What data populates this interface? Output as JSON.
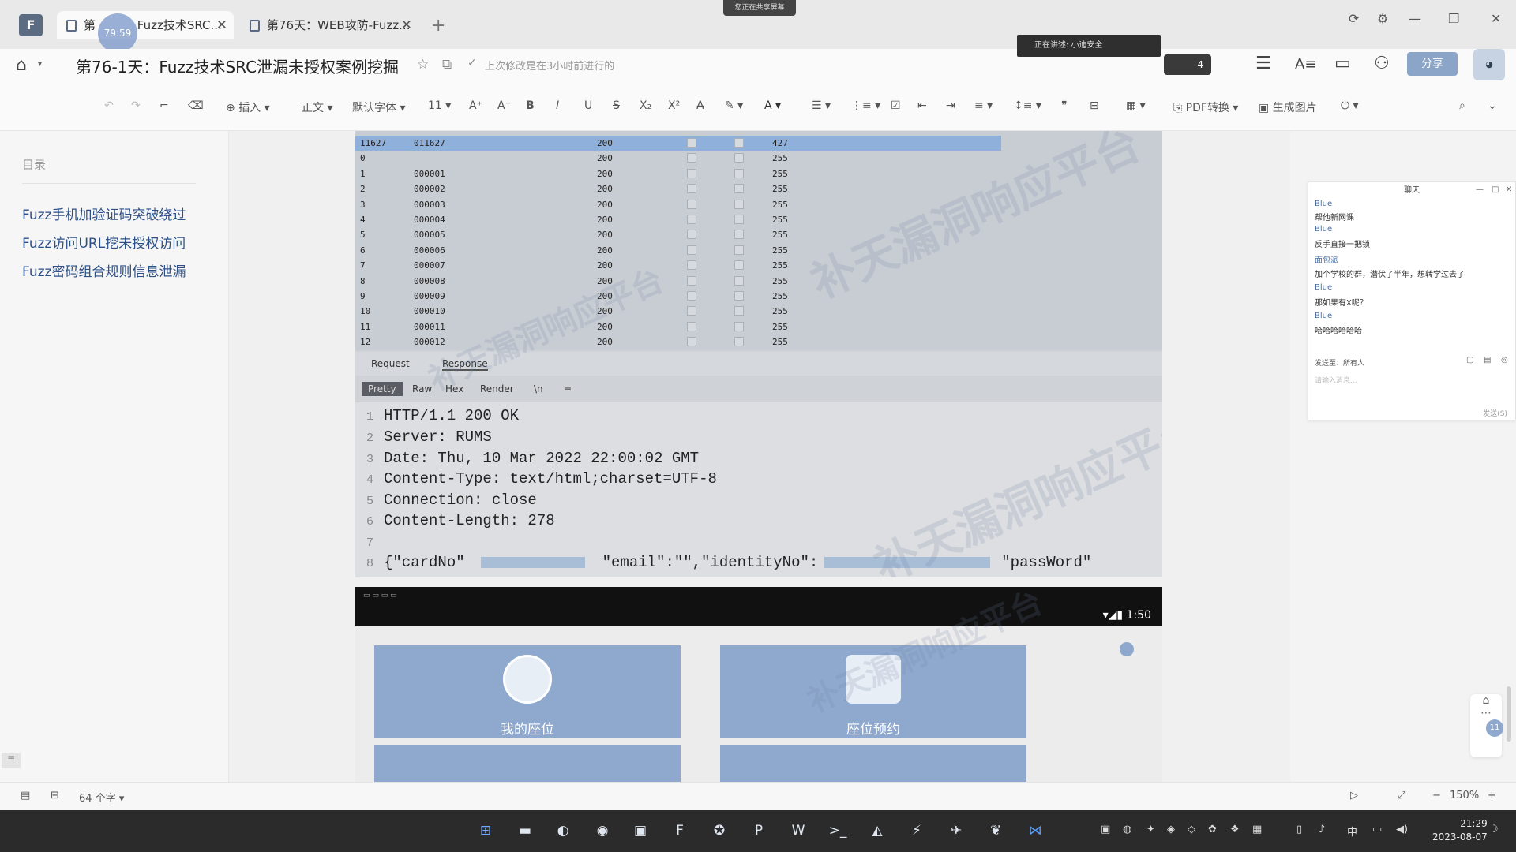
{
  "tabs": [
    {
      "label": "第",
      "suffix": "Fuzz技术SRC...",
      "active": true
    },
    {
      "label": "第76天：WEB攻防-Fuzz...",
      "active": false
    }
  ],
  "timer": "79:59",
  "share_banner": "您正在共享屏幕",
  "doc": {
    "title": "第76-1天：Fuzz技术SRC泄漏未授权案例挖掘",
    "save_status": "上次修改是在3小时前进行的"
  },
  "speaker": "正在讲述: 小迪安全",
  "collab_count": "4",
  "share_button": "分享",
  "toolbar": {
    "insert": "插入",
    "paragraph_style": "正文",
    "font": "默认字体",
    "font_size": "11",
    "pdf": "PDF转换",
    "gen_image": "生成图片"
  },
  "sidebar": {
    "title": "目录",
    "items": [
      {
        "label": "Fuzz手机加验证码突破绕过"
      },
      {
        "label": "Fuzz访问URL挖未授权访问"
      },
      {
        "label": "Fuzz密码组合规则信息泄漏"
      }
    ]
  },
  "burp": {
    "rows": [
      {
        "n": "11627",
        "payload": "011627",
        "status": "200",
        "len": "427",
        "selected": true
      },
      {
        "n": "0",
        "payload": "",
        "status": "200",
        "len": "255"
      },
      {
        "n": "1",
        "payload": "000001",
        "status": "200",
        "len": "255"
      },
      {
        "n": "2",
        "payload": "000002",
        "status": "200",
        "len": "255"
      },
      {
        "n": "3",
        "payload": "000003",
        "status": "200",
        "len": "255"
      },
      {
        "n": "4",
        "payload": "000004",
        "status": "200",
        "len": "255"
      },
      {
        "n": "5",
        "payload": "000005",
        "status": "200",
        "len": "255"
      },
      {
        "n": "6",
        "payload": "000006",
        "status": "200",
        "len": "255"
      },
      {
        "n": "7",
        "payload": "000007",
        "status": "200",
        "len": "255"
      },
      {
        "n": "8",
        "payload": "000008",
        "status": "200",
        "len": "255"
      },
      {
        "n": "9",
        "payload": "000009",
        "status": "200",
        "len": "255"
      },
      {
        "n": "10",
        "payload": "000010",
        "status": "200",
        "len": "255"
      },
      {
        "n": "11",
        "payload": "000011",
        "status": "200",
        "len": "255"
      },
      {
        "n": "12",
        "payload": "000012",
        "status": "200",
        "len": "255"
      }
    ],
    "tab_request": "Request",
    "tab_response": "Response",
    "sub_tabs": [
      "Pretty",
      "Raw",
      "Hex",
      "Render",
      "\\n",
      "≡"
    ],
    "response_lines": [
      "HTTP/1.1 200 OK",
      "Server: RUMS",
      "Date: Thu, 10 Mar 2022 22:00:02 GMT",
      "Content-Type: text/html;charset=UTF-8",
      "Connection: close",
      "Content-Length: 278",
      "",
      "{\"cardNo\""
    ],
    "line8_mid": "\"email\":\"\",\"identityNo\":",
    "line8_end": "\"passWord\"",
    "watermark": "补天漏洞响应平台"
  },
  "phone": {
    "status": "1:50",
    "tile1": "我的座位",
    "tile2": "座位预约"
  },
  "chat": {
    "title": "聊天",
    "lines": [
      {
        "text": "Blue",
        "name": true
      },
      {
        "text": "帮他新网课",
        "name": false
      },
      {
        "text": "Blue",
        "name": true
      },
      {
        "text": "反手直接一把锁",
        "name": false
      },
      {
        "text": "面包派",
        "name": true
      },
      {
        "text": "加个学校的群，潜伏了半年，想转学过去了",
        "name": false
      },
      {
        "text": "Blue",
        "name": true
      },
      {
        "text": "那如果有X呢？",
        "name": false
      },
      {
        "text": "Blue",
        "name": true
      },
      {
        "text": "哈哈哈哈哈哈",
        "name": false
      }
    ],
    "send_to": "发送至：所有人",
    "placeholder": "请输入消息...",
    "send": "发送(S)"
  },
  "side_badge": "11",
  "status_bar": {
    "word_count": "64 个字",
    "zoom": "150%"
  },
  "clock": {
    "time": "21:29",
    "date": "2023-08-07"
  }
}
